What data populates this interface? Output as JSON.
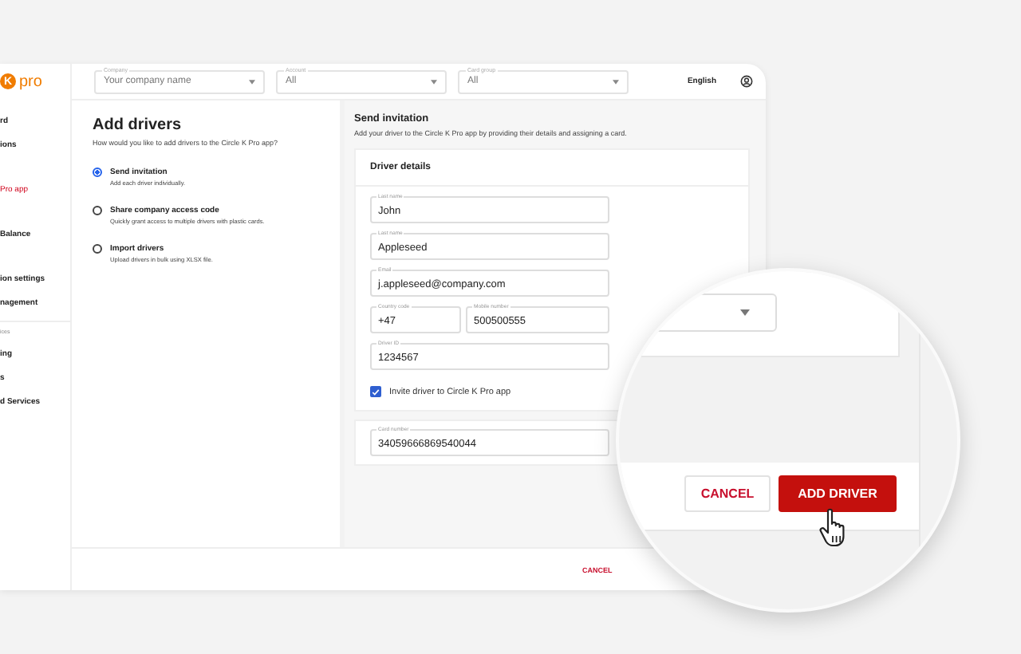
{
  "sidebar": {
    "logo": {
      "mark": "K",
      "text": "pro"
    },
    "items": [
      {
        "label": "rd",
        "selected": false
      },
      {
        "label": "ions",
        "selected": false
      },
      {
        "label": "Pro app",
        "selected": true
      },
      {
        "label": "Balance",
        "selected": false
      },
      {
        "label": "ion settings",
        "selected": false
      },
      {
        "label": "nagement",
        "selected": false
      }
    ],
    "section_label": "ices",
    "section_items": [
      {
        "label": "ing",
        "selected": false
      },
      {
        "label": "s",
        "selected": false
      },
      {
        "label": "d Services",
        "selected": false
      }
    ]
  },
  "filters": [
    {
      "label": "Company",
      "value": "Your company name"
    },
    {
      "label": "Account",
      "value": "All"
    },
    {
      "label": "Card group",
      "value": "All"
    }
  ],
  "language": "English",
  "add_drivers": {
    "title": "Add drivers",
    "subtitle": "How would you like to add drivers to the Circle K Pro app?",
    "options": [
      {
        "title": "Send invitation",
        "description": "Add each driver individually.",
        "selected": true
      },
      {
        "title": "Share company access code",
        "description": "Quickly grant access to multiple drivers with plastic cards.",
        "selected": false
      },
      {
        "title": "Import drivers",
        "description": "Upload drivers in bulk using XLSX file.",
        "selected": false
      }
    ]
  },
  "send_invitation": {
    "title": "Send invitation",
    "description": "Add your driver to the Circle K Pro app by providing their details and assigning a card.",
    "driver_details": {
      "title": "Driver details",
      "fields": [
        {
          "label": "Last name",
          "value": "John"
        },
        {
          "label": "Last name",
          "value": "Appleseed"
        },
        {
          "label": "Email",
          "value": "j.appleseed@company.com"
        }
      ],
      "phone": {
        "code": {
          "label": "Country code",
          "value": "+47"
        },
        "mobile": {
          "label": "Mobile number",
          "value": "500500555"
        }
      },
      "driver_id": {
        "label": "Driver ID",
        "value": "1234567"
      },
      "invite": {
        "label": "Invite driver to Circle K Pro app",
        "checked": true
      }
    },
    "card_number": {
      "label": "Card number",
      "value": "34059666869540044"
    }
  },
  "footer": {
    "cancel": "CANCEL"
  },
  "magnifier": {
    "cancel": "CANCEL",
    "add": "ADD DRIVER"
  }
}
